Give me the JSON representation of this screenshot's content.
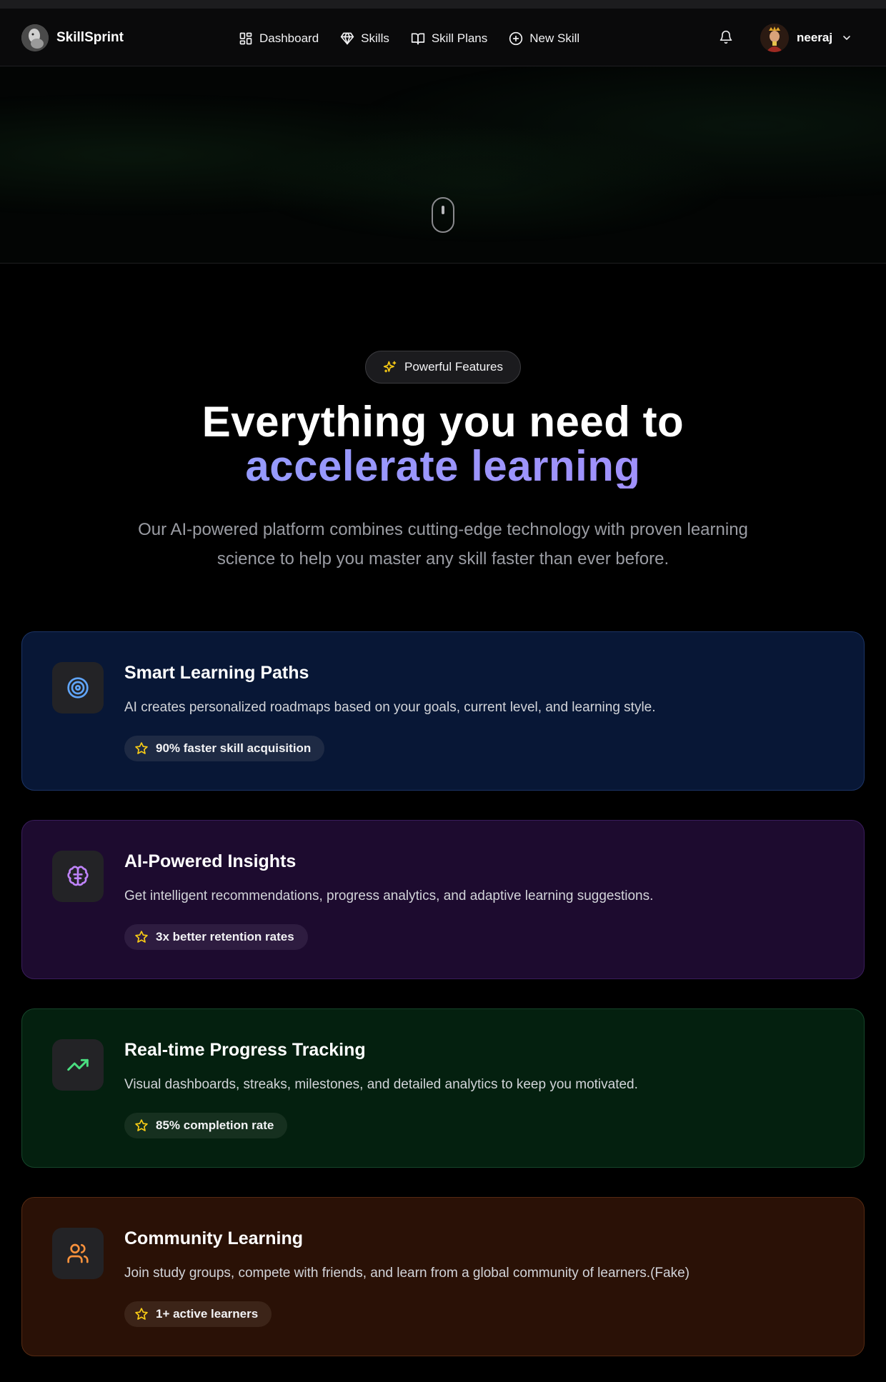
{
  "app": {
    "name": "SkillSprint"
  },
  "nav": {
    "items": [
      {
        "label": "Dashboard",
        "icon": "dashboard-icon"
      },
      {
        "label": "Skills",
        "icon": "gem-icon"
      },
      {
        "label": "Skill Plans",
        "icon": "book-icon"
      },
      {
        "label": "New Skill",
        "icon": "plus-circle-icon"
      }
    ],
    "notifications_icon": "bell-icon",
    "user": {
      "name": "neeraj",
      "menu_icon": "chevron-down-icon"
    }
  },
  "features_section": {
    "badge": "Powerful Features",
    "headline_line1": "Everything you need to",
    "headline_line2": "accelerate learning",
    "subtext": "Our AI-powered platform combines cutting-edge technology with proven learning science to help you master any skill faster than ever before.",
    "cards": [
      {
        "title": "Smart Learning Paths",
        "description": "AI creates personalized roadmaps based on your goals, current level, and learning style.",
        "stat": "90% faster skill acquisition",
        "icon": "target-icon",
        "accent": "#60a5fa"
      },
      {
        "title": "AI-Powered Insights",
        "description": "Get intelligent recommendations, progress analytics, and adaptive learning suggestions.",
        "stat": "3x better retention rates",
        "icon": "brain-icon",
        "accent": "#c084fc"
      },
      {
        "title": "Real-time Progress Tracking",
        "description": "Visual dashboards, streaks, milestones, and detailed analytics to keep you motivated.",
        "stat": "85% completion rate",
        "icon": "trending-up-icon",
        "accent": "#4ade80"
      },
      {
        "title": "Community Learning",
        "description": "Join study groups, compete with friends, and learn from a global community of learners.(Fake)",
        "stat": "1+ active learners",
        "icon": "users-icon",
        "accent": "#fb923c"
      }
    ]
  },
  "colors": {
    "background": "#000000",
    "star": "#facc15",
    "headline_gradient_start": "#8ea0ff",
    "headline_gradient_end": "#a78bfa"
  }
}
